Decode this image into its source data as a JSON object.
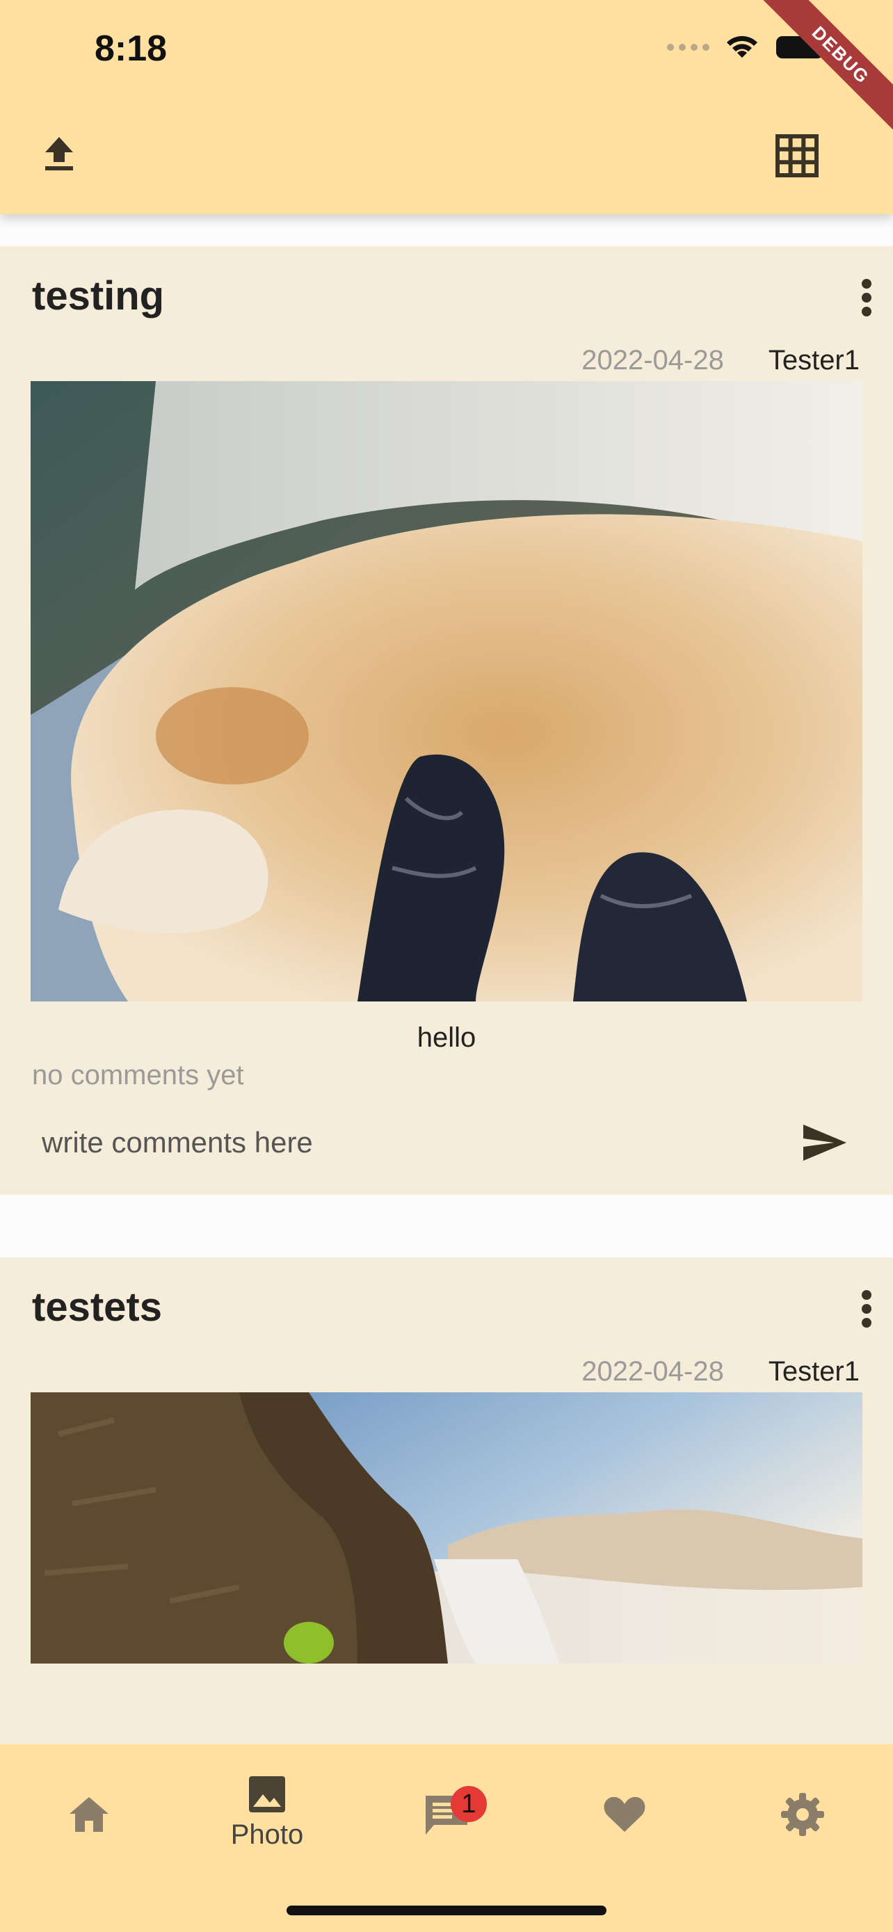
{
  "status_bar": {
    "time": "8:18"
  },
  "debug_banner": "DEBUG",
  "app_bar": {
    "left_icon": "upload-icon",
    "right_icon": "grid-view-icon"
  },
  "posts": [
    {
      "title": "testing",
      "date": "2022-04-28",
      "author": "Tester1",
      "image": "photo of a golden retriever lying on a bed",
      "caption": "hello",
      "comments_status": "no comments yet",
      "comment_placeholder": "write comments here"
    },
    {
      "title": "testets",
      "date": "2022-04-28",
      "author": "Tester1",
      "image": "photo of a waterfall by a cliff at sunset"
    }
  ],
  "bottom_nav": {
    "items": [
      {
        "icon": "home-icon",
        "label": ""
      },
      {
        "icon": "image-icon",
        "label": "Photo"
      },
      {
        "icon": "chat-icon",
        "label": "",
        "badge": "1"
      },
      {
        "icon": "heart-icon",
        "label": ""
      },
      {
        "icon": "settings-icon",
        "label": ""
      }
    ],
    "active_index": 1
  },
  "colors": {
    "app_bar": "#ffe0a1",
    "card_background": "#f5ecd9",
    "badge": "#e53935",
    "icon_inactive": "#8a7d6a",
    "icon_active": "#4a4336"
  }
}
